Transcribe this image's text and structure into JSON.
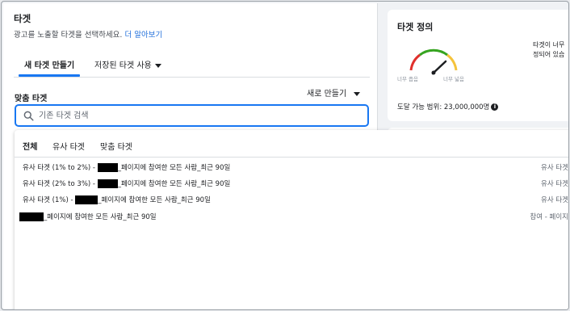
{
  "header": {
    "title": "타겟",
    "subtitle": "광고를 노출할 타겟을 선택하세요.",
    "learn_more": "더 알아보기"
  },
  "tabs": {
    "new_audience": "새 타겟 만들기",
    "saved_audience": "저장된 타겟 사용"
  },
  "custom_audience": {
    "label": "맞춤 타겟",
    "create_new": "새로 만들기",
    "search_placeholder": "기존 타겟 검색"
  },
  "dropdown": {
    "tabs": [
      "전체",
      "유사 타겟",
      "맞춤 타겟"
    ],
    "rows": [
      {
        "prefix": "유사 타겟 (1% to 2%) - ",
        "suffix": "_페이지에 참여한 모든 사람_최근 90일",
        "type": "유사 타겟"
      },
      {
        "prefix": "유사 타겟 (2% to 3%) - ",
        "suffix": "_페이지에 참여한 모든 사람_최근 90일",
        "type": "유사 타겟"
      },
      {
        "prefix": "유사 타겟 (1%) - ",
        "suffix": "_페이지에 참여한 모든 사람_최근 90일",
        "type": "유사 타겟"
      },
      {
        "prefix": "",
        "suffix": "_페이지에 참여한 모든 사람_최근 90일",
        "type": "참여 - 페이지"
      }
    ]
  },
  "audience_definition": {
    "title": "타겟 정의",
    "desc_line1": "타겟이 너무",
    "desc_line2": "정되어 있습",
    "gauge_left": "너무 좁음",
    "gauge_right": "너무 넓음",
    "reach_label": "도달 가능 범위: 23,000,000명"
  }
}
